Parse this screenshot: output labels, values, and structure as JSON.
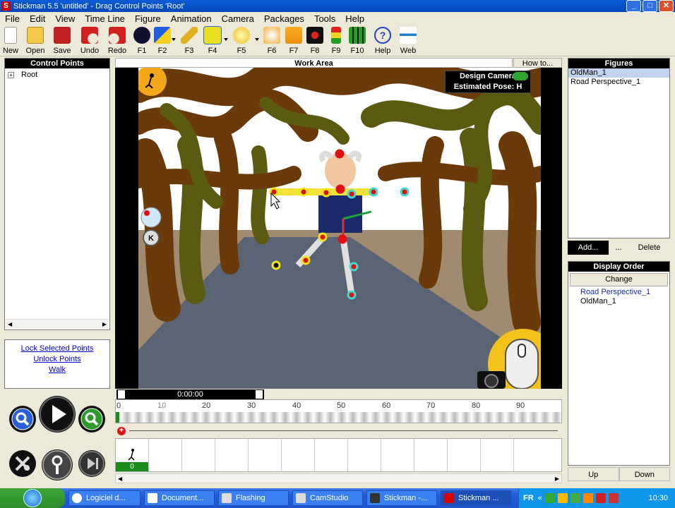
{
  "window": {
    "title": "Stickman 5.5  'untitled' - Drag Control Points 'Root'",
    "app_icon": "S"
  },
  "menu": [
    "File",
    "Edit",
    "View",
    "Time Line",
    "Figure",
    "Animation",
    "Camera",
    "Packages",
    "Tools",
    "Help"
  ],
  "toolbar": {
    "new": "New",
    "open": "Open",
    "save": "Save",
    "undo": "Undo",
    "redo": "Redo",
    "f1": "F1",
    "f2": "F2",
    "f3": "F3",
    "f4": "F4",
    "f5": "F5",
    "f6": "F6",
    "f7": "F7",
    "f8": "F8",
    "f9": "F9",
    "f10": "F10",
    "help": "Help",
    "web": "Web"
  },
  "control_points": {
    "header": "Control Points",
    "tree_root": "Root",
    "tree_expander": "+"
  },
  "links": {
    "lock": "Lock Selected Points",
    "unlock": "Unlock Points",
    "walk": "Walk"
  },
  "work_area": {
    "header": "Work Area",
    "how_to": "How to...",
    "camera_label": "Design Camera",
    "pose_label": "Estimated Pose: H",
    "key_marker": "K"
  },
  "timeline": {
    "time": "0:00:00",
    "ruler_ticks": [
      "0",
      "10",
      "20",
      "30",
      "40",
      "50",
      "60",
      "70",
      "80",
      "90"
    ],
    "frame_number": "0",
    "add_marker": "+"
  },
  "figures": {
    "header": "Figures",
    "items": [
      "OldMan_1",
      "Road Perspective_1"
    ],
    "selected": "OldMan_1",
    "add": "Add...",
    "more": "...",
    "delete": "Delete"
  },
  "display_order": {
    "header": "Display Order",
    "change": "Change",
    "items": [
      "Road Perspective_1",
      "OldMan_1"
    ],
    "up": "Up",
    "down": "Down"
  },
  "taskbar": {
    "tasks": [
      "Logiciel d...",
      "Document...",
      "Flashing",
      "CamStudio",
      "Stickman -...",
      "Stickman ..."
    ],
    "active_task": "Stickman ...",
    "tray_lang": "FR",
    "clock": "10:30"
  },
  "colors": {
    "titlebar": "#0a5cd6",
    "sky": "#ffffff",
    "tree_brown": "#6b3a0a",
    "tree_olive": "#5a5a10",
    "road": "#5a6070",
    "ground": "#a08a70",
    "joint_red": "#e01010",
    "joint_ring_yellow": "#f2e21a",
    "joint_ring_cyan": "#40d8d0",
    "frame_green": "#1a8a1a"
  }
}
